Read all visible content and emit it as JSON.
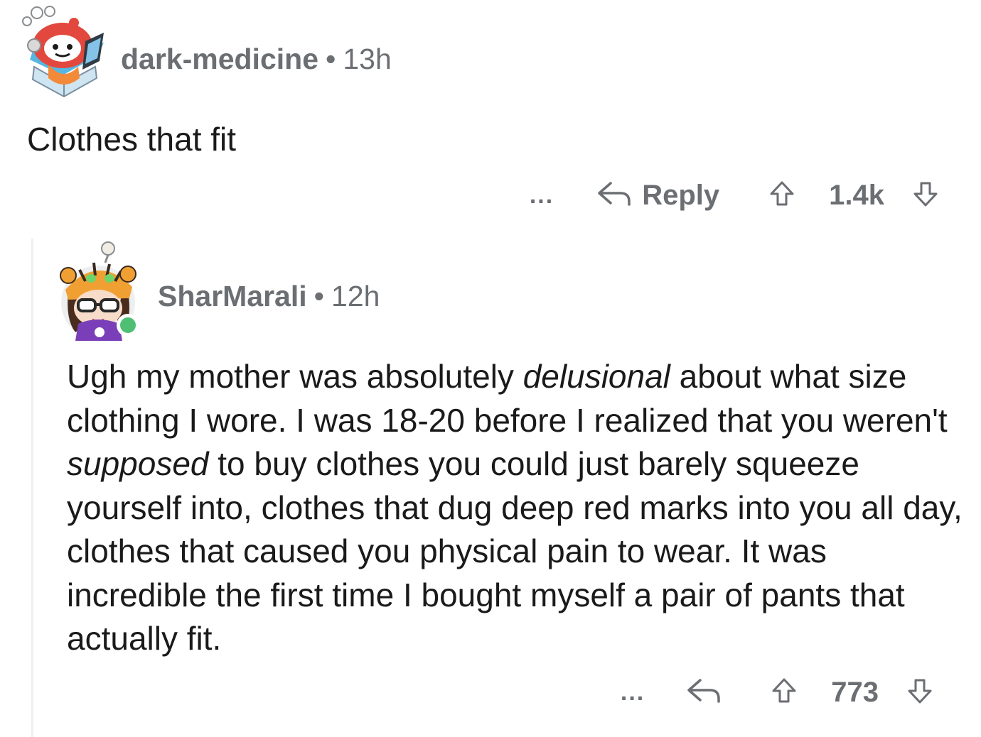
{
  "parent_comment": {
    "author": "dark-medicine",
    "separator": "•",
    "age": "13h",
    "body": "Clothes that fit",
    "actions": {
      "more": "...",
      "reply_label": "Reply",
      "score": "1.4k"
    }
  },
  "reply_comment": {
    "author": "SharMarali",
    "separator": "•",
    "age": "12h",
    "online": true,
    "body_segments": [
      "Ugh my mother was absolutely ",
      "delusional",
      " about what size clothing I wore. I was 18-20 before I realized that you weren't ",
      "supposed",
      " to buy clothes you could just barely squeeze yourself into, clothes that dug deep red marks into you all day, clothes that caused you physical pain to wear. It was incredible the first time I bought myself a pair of pants that actually fit."
    ],
    "actions": {
      "more": "...",
      "score": "773"
    }
  },
  "icons": {
    "reply": "reply-arrow-icon",
    "upvote": "upvote-arrow-icon",
    "downvote": "downvote-arrow-icon",
    "more": "more-dots-icon"
  },
  "colors": {
    "meta_text": "#6b6e72",
    "body_text": "#1a1a1b",
    "online": "#4fbf73",
    "thread_line": "#edeff1",
    "snoo_red": "#e2483d"
  }
}
